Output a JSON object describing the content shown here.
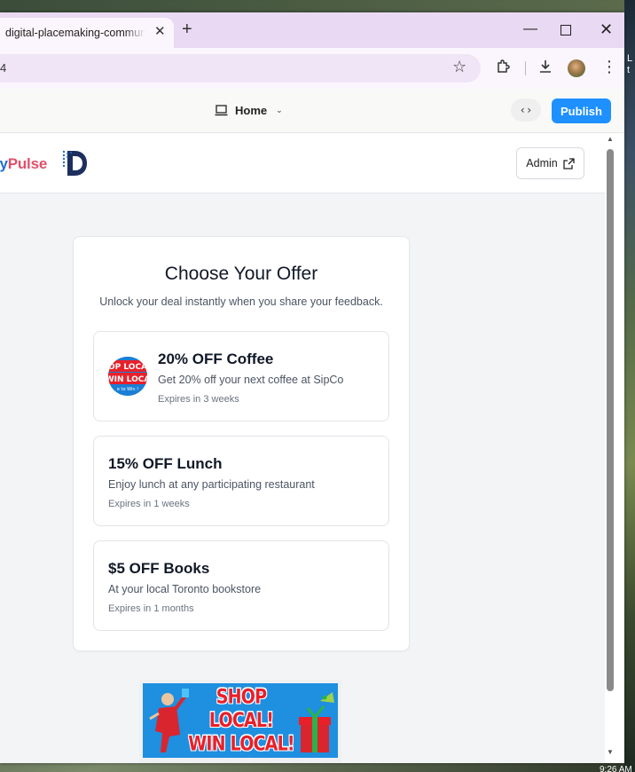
{
  "browser": {
    "tab_title": "digital-placemaking-community",
    "tab_close": "✕",
    "new_tab": "+",
    "url_fragment": "4",
    "window_controls": {
      "minimize": "—",
      "close": "✕"
    }
  },
  "app_bar": {
    "page_label": "Home",
    "code_toggle": "‹›",
    "publish_label": "Publish"
  },
  "site": {
    "brand_part_a": "ty",
    "brand_part_b": "Pulse",
    "admin_label": "Admin"
  },
  "offers_card": {
    "heading": "Choose Your Offer",
    "subheading": "Unlock your deal instantly when you share your feedback.",
    "offers": [
      {
        "title": "20% OFF Coffee",
        "description": "Get 20% off your next coffee at SipCo",
        "expires": "Expires in 3 weeks",
        "has_image": true
      },
      {
        "title": "15% OFF Lunch",
        "description": "Enjoy lunch at any participating restaurant",
        "expires": "Expires in 1 weeks",
        "has_image": false
      },
      {
        "title": "$5 OFF Books",
        "description": "At your local Toronto bookstore",
        "expires": "Expires in 1 months",
        "has_image": false
      }
    ]
  },
  "thumb_text": {
    "line1": "OP LOCA",
    "line2": "WIN LOCA",
    "line3": "e to Win !"
  },
  "banner": {
    "line1": "SHOP LOCAL!",
    "line2": "WIN LOCAL!"
  },
  "desktop": {
    "edge_text_1": "L",
    "edge_text_2": "t",
    "clock": "9:26 AM"
  },
  "colors": {
    "publish": "#1e90ff",
    "brand_blue": "#1f6fd1",
    "brand_pink": "#e0506a",
    "tab_bar": "#e9d9f2"
  }
}
